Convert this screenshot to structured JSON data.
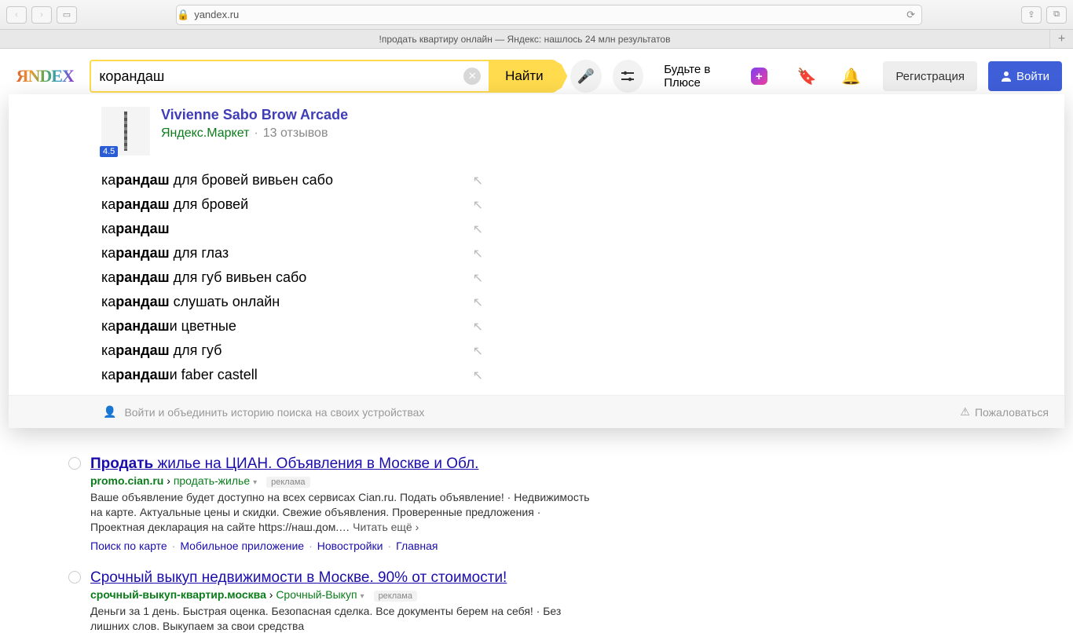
{
  "browser": {
    "url": "yandex.ru",
    "tab_title": "!продать квартиру онлайн — Яндекс: нашлось 24 млн результатов"
  },
  "header": {
    "logo_text": "ЯNDEX",
    "search_value": "корандаш",
    "search_button": "Найти",
    "plus_promo": "Будьте в Плюсе",
    "register": "Регистрация",
    "login": "Войти"
  },
  "suggest": {
    "product": {
      "title": "Vivienne Sabo Brow Arcade",
      "store": "Яндекс.Маркет",
      "reviews": "13 отзывов",
      "rating": "4.5"
    },
    "items": [
      {
        "bold_pre": "ка",
        "bold_mid": "рандаш",
        "rest": " для бровей вивьен сабо"
      },
      {
        "bold_pre": "ка",
        "bold_mid": "рандаш",
        "rest": " для бровей"
      },
      {
        "bold_pre": "ка",
        "bold_mid": "рандаш",
        "rest": ""
      },
      {
        "bold_pre": "ка",
        "bold_mid": "рандаш",
        "rest": " для глаз"
      },
      {
        "bold_pre": "ка",
        "bold_mid": "рандаш",
        "rest": " для губ вивьен сабо"
      },
      {
        "bold_pre": "ка",
        "bold_mid": "рандаш",
        "rest": " слушать онлайн"
      },
      {
        "bold_pre": "ка",
        "bold_mid": "рандаш",
        "rest": "и цветные"
      },
      {
        "bold_pre": "ка",
        "bold_mid": "рандаш",
        "rest": " для губ"
      },
      {
        "bold_pre": "ка",
        "bold_mid": "рандаш",
        "rest": "и faber castell"
      }
    ],
    "footer_left": "Войти и объединить историю поиска на своих устройствах",
    "footer_right": "Пожаловаться"
  },
  "results": [
    {
      "title_bold": "Продать",
      "title_rest": " жилье на ЦИАН. Объявления в Москве и Обл.",
      "domain": "promo.cian.ru",
      "path": "продать-жилье",
      "ad": "реклама",
      "text": "Ваше объявление будет доступно на всех сервисах Cian.ru. Подать объявление! · Недвижимость на карте. Актуальные цены и скидки. Свежие объявления. Проверенные предложения · Проектная декларация на сайте https://наш.дом.… ",
      "more": "Читать ещё ›",
      "links": [
        "Поиск по карте",
        "Мобильное приложение",
        "Новостройки",
        "Главная"
      ]
    },
    {
      "title_bold": "",
      "title_rest": "Срочный выкуп недвижимости в Москве. 90% от стоимости!",
      "domain": "срочный-выкуп-квартир.москва",
      "path": "Срочный-Выкуп",
      "ad": "реклама",
      "text": "Деньги за 1 день. Быстрая оценка. Безопасная сделка. Все документы берем на себя! · Без лишних слов. Выкупаем за свои средства",
      "more": "",
      "links": []
    }
  ]
}
